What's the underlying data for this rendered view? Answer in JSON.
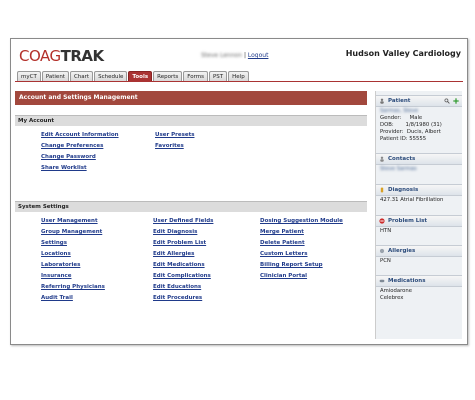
{
  "app": {
    "logo_coag": "COAG",
    "logo_trak": "TRAK",
    "user_name": "Steve Lennon",
    "logout": "Logout",
    "separator": "|",
    "organization": "Hudson Valley Cardiology"
  },
  "tabs": [
    {
      "label": "myCT"
    },
    {
      "label": "Patient"
    },
    {
      "label": "Chart"
    },
    {
      "label": "Schedule"
    },
    {
      "label": "Tools",
      "active": true
    },
    {
      "label": "Reports"
    },
    {
      "label": "Forms"
    },
    {
      "label": "PST"
    },
    {
      "label": "Help"
    }
  ],
  "page_title": "Account and Settings Management",
  "my_account": {
    "title": "My Account",
    "col1": [
      "Edit Account Information",
      "Change Preferences",
      "Change Password",
      "Share Worklist"
    ],
    "col2": [
      "User Presets",
      "Favorites"
    ]
  },
  "system_settings": {
    "title": "System Settings",
    "col1": [
      "User Management",
      "Group Management",
      "Settings",
      "Locations",
      "Laboratories",
      "Insurance",
      "Referring Physicians",
      "Audit Trail"
    ],
    "col2": [
      "User Defined Fields",
      "Edit Diagnosis",
      "Edit Problem List",
      "Edit Allergies",
      "Edit Medications",
      "Edit Complications",
      "Edit Educations",
      "Edit Procedures"
    ],
    "col3": [
      "Dosing Suggestion Module",
      "Merge Patient",
      "Delete Patient",
      "Custom Letters",
      "Billing Report Setup",
      "Clinician Portal"
    ]
  },
  "sidebar": {
    "patient": {
      "title": "Patient",
      "name": "Sarmas, Steve",
      "gender_label": "Gender:",
      "gender": "Male",
      "dob_label": "DOB:",
      "dob": "1/8/1980 (31)",
      "provider_label": "Provider:",
      "provider": "Ducis, Albert",
      "patient_id_label": "Patient ID:",
      "patient_id": "55555"
    },
    "contacts": {
      "title": "Contacts",
      "value": "Steve Sarmas"
    },
    "diagnosis": {
      "title": "Diagnosis",
      "value": "427.31 Atrial Fibrillation"
    },
    "problem_list": {
      "title": "Problem List",
      "value": "HTN"
    },
    "allergies": {
      "title": "Allergies",
      "value": "PCN"
    },
    "medications": {
      "title": "Medications",
      "values": [
        "Amiodarone",
        "Celebrex"
      ]
    }
  },
  "colors": {
    "accent": "#a33333",
    "header_red": "#a2483d",
    "link": "#1f3a8a"
  }
}
